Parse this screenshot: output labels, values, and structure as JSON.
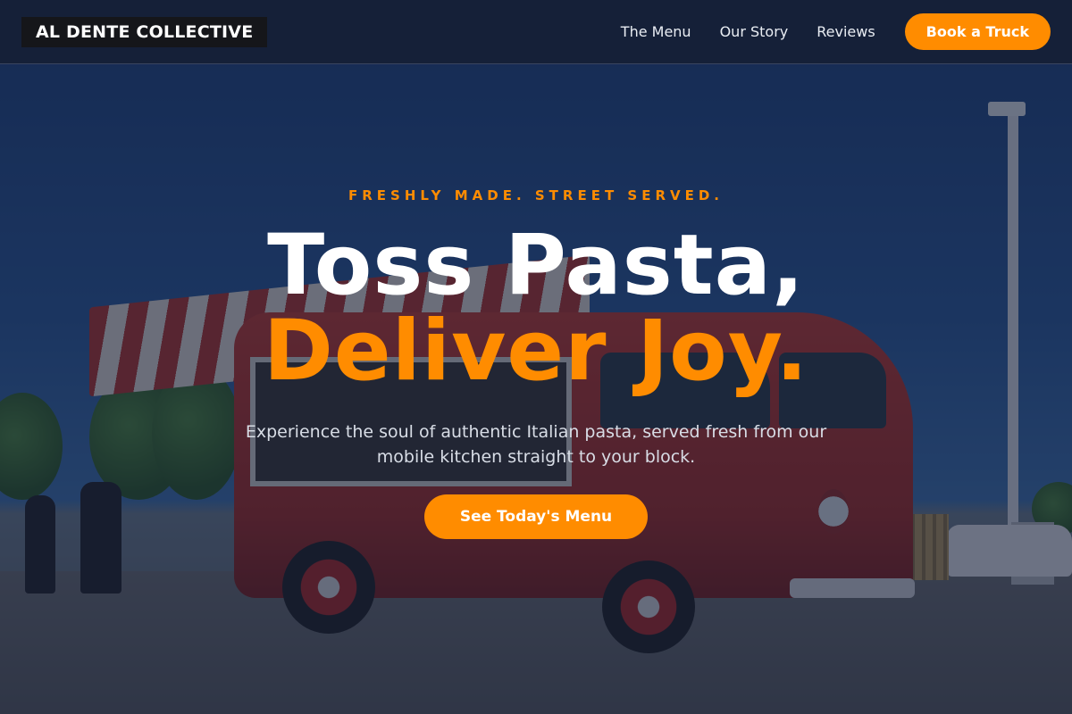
{
  "nav": {
    "brand": "AL DENTE COLLECTIVE",
    "links": [
      "The Menu",
      "Our Story",
      "Reviews"
    ],
    "cta": "Book a Truck"
  },
  "hero": {
    "eyebrow": "FRESHLY MADE. STREET SERVED.",
    "headline_line1": "Toss Pasta,",
    "headline_line2": "Deliver Joy.",
    "subtext": "Experience the soul of authentic Italian pasta, served fresh from our mobile kitchen straight to your block.",
    "cta": "See Today's Menu",
    "background_image": "red-food-truck-van"
  },
  "colors": {
    "accent": "#ff8c00",
    "nav_bg": "#162036",
    "text_light": "#ffffff"
  }
}
